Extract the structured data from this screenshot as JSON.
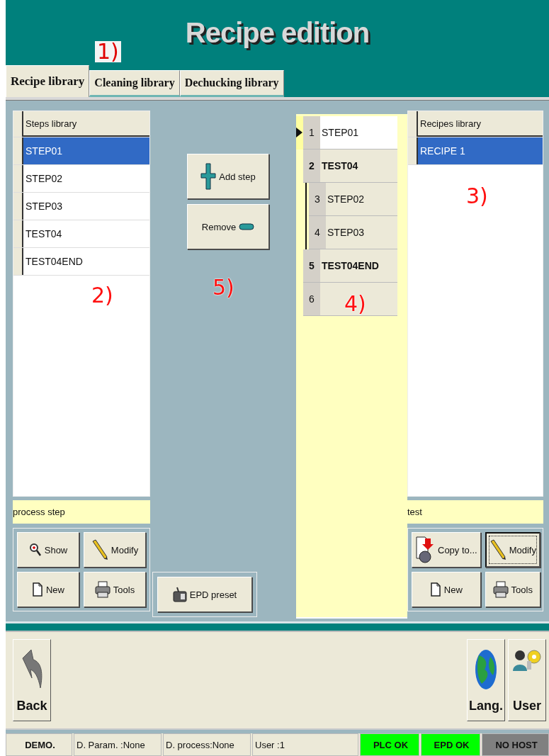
{
  "header": {
    "title": "Recipe edition",
    "marker": "1)"
  },
  "tabs": [
    {
      "label": "Recipe library",
      "selected": true
    },
    {
      "label": "Cleaning library",
      "selected": false
    },
    {
      "label": "Dechucking library",
      "selected": false
    }
  ],
  "steps_panel": {
    "header": "Steps library",
    "marker": "2)",
    "rows": [
      {
        "label": "STEP01",
        "selected": true
      },
      {
        "label": "STEP02",
        "selected": false
      },
      {
        "label": "STEP03",
        "selected": false
      },
      {
        "label": "TEST04",
        "selected": false
      },
      {
        "label": "TEST04END",
        "selected": false
      }
    ],
    "description": "process step",
    "buttons": [
      {
        "kind": "show",
        "label": "Show",
        "focused": false
      },
      {
        "kind": "modify",
        "label": "Modify",
        "focused": false
      },
      {
        "kind": "new",
        "label": "New",
        "focused": false
      },
      {
        "kind": "tools",
        "label": "Tools",
        "focused": false
      }
    ]
  },
  "actions": {
    "marker": "5)",
    "buttons": [
      {
        "kind": "add",
        "label": "Add step"
      },
      {
        "kind": "remove",
        "label": "Remove"
      }
    ],
    "preset_button": {
      "kind": "preset",
      "label": "EPD preset"
    }
  },
  "sequence": {
    "marker": "4)",
    "rows": [
      {
        "number": "1",
        "name": "STEP01",
        "kind": "step",
        "current": true,
        "selected": true
      },
      {
        "number": "2",
        "name": "TEST04",
        "kind": "group",
        "current": false,
        "selected": false,
        "children": [
          {
            "number": "3",
            "name": "STEP02",
            "kind": "step",
            "current": false,
            "selected": false
          },
          {
            "number": "4",
            "name": "STEP03",
            "kind": "step",
            "current": false,
            "selected": false
          }
        ]
      },
      {
        "number": "5",
        "name": "TEST04END",
        "kind": "group",
        "current": false,
        "selected": false
      },
      {
        "number": "6",
        "kind": "empty",
        "current": false,
        "selected": false
      }
    ]
  },
  "recipes_panel": {
    "header": "Recipes library",
    "marker": "3)",
    "rows": [
      {
        "label": "RECIPE 1",
        "selected": true
      }
    ],
    "description": "test",
    "buttons": [
      {
        "kind": "copy",
        "label": "Copy to...",
        "focused": false
      },
      {
        "kind": "modify",
        "label": "Modify",
        "focused": true
      },
      {
        "kind": "new",
        "label": "New",
        "focused": false
      },
      {
        "kind": "tools",
        "label": "Tools",
        "focused": false
      }
    ]
  },
  "bottom_bar": {
    "buttons": [
      {
        "kind": "back",
        "label": "Back"
      },
      {
        "kind": "language",
        "label": "Lang."
      },
      {
        "kind": "user",
        "label": "User"
      }
    ]
  },
  "status_bar": [
    {
      "text": "DEMO.",
      "kind": "indicator",
      "color": "#ece9d8"
    },
    {
      "text": "D. Param. :None",
      "kind": "field",
      "color": "#ece9d8"
    },
    {
      "text": "D. process:None",
      "kind": "field",
      "color": "#ece9d8"
    },
    {
      "text": "User :1",
      "kind": "field",
      "color": "#ece9d8"
    },
    {
      "text": "PLC OK",
      "kind": "indicator",
      "color": "#00ff00"
    },
    {
      "text": "EPD OK",
      "kind": "indicator",
      "color": "#00ff00"
    },
    {
      "text": "NO HOST",
      "kind": "indicator",
      "color": "#808080"
    }
  ]
}
